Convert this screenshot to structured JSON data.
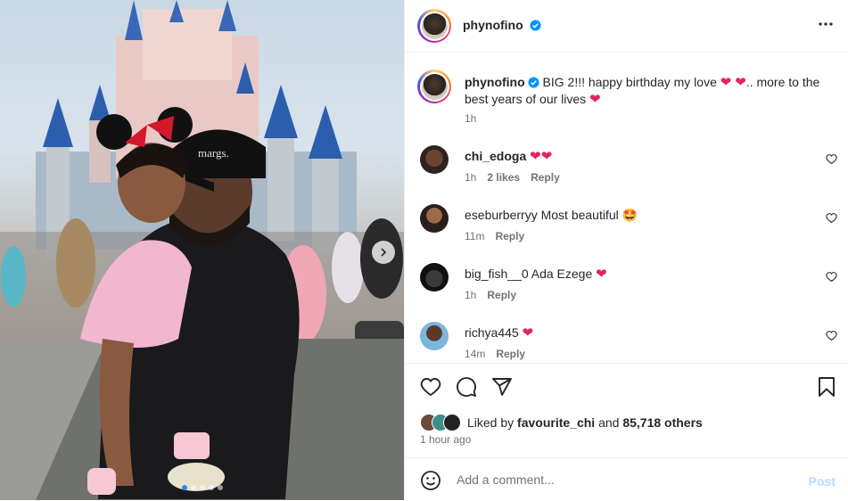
{
  "colors": {
    "accent": "#0095f6",
    "verified": "#0095f6",
    "heart": "#e0245e",
    "muted": "#737373"
  },
  "photo": {
    "carousel_dots": 5,
    "active_dot": 0,
    "next_icon": "chevron-right-icon"
  },
  "header": {
    "username": "phynofino",
    "more_icon": "more-horizontal-icon"
  },
  "caption": {
    "username": "phynofino",
    "text_1": "BIG 2!!! happy birthday my love",
    "text_2": ".. more to the best years of our lives",
    "time": "1h"
  },
  "comments": [
    {
      "username": "chi_edoga",
      "text": "",
      "emoji": "❤️❤️",
      "time": "1h",
      "likes": "2 likes",
      "reply": "Reply"
    },
    {
      "username": "eseburberryy",
      "text": "Most beautiful",
      "emoji": "🤩",
      "time": "11m",
      "likes": "",
      "reply": "Reply"
    },
    {
      "username": "big_fish__0",
      "text": "Ada Ezege",
      "emoji": "❤️",
      "time": "1h",
      "likes": "",
      "reply": "Reply"
    },
    {
      "username": "richya445",
      "text": "",
      "emoji": "❤️",
      "time": "14m",
      "likes": "",
      "reply": "Reply"
    }
  ],
  "likes": {
    "prefix": "Liked by",
    "user": "favourite_chi",
    "middle": "and",
    "count": "85,718 others"
  },
  "posted": "1 hour ago",
  "composer": {
    "placeholder": "Add a comment...",
    "post_label": "Post"
  }
}
